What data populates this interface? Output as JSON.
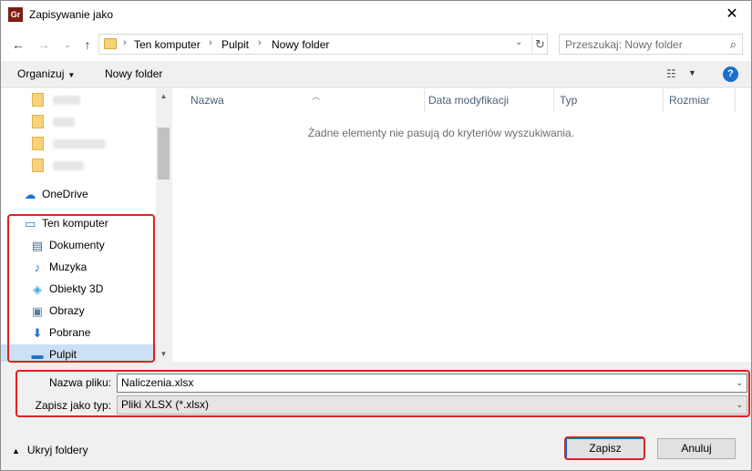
{
  "window": {
    "title": "Zapisywanie jako",
    "app_icon_label": "Gr",
    "close_glyph": "✕"
  },
  "address": {
    "breadcrumbs": [
      "Ten komputer",
      "Pulpit",
      "Nowy folder"
    ],
    "search_placeholder": "Przeszukaj: Nowy folder"
  },
  "toolbar": {
    "organize_label": "Organizuj",
    "new_folder_label": "Nowy folder"
  },
  "navpane": {
    "onedrive_label": "OneDrive",
    "this_pc_label": "Ten komputer",
    "items": [
      {
        "label": "Dokumenty",
        "icon": "document-icon"
      },
      {
        "label": "Muzyka",
        "icon": "music-icon"
      },
      {
        "label": "Obiekty 3D",
        "icon": "cube-icon"
      },
      {
        "label": "Obrazy",
        "icon": "pictures-icon"
      },
      {
        "label": "Pobrane",
        "icon": "download-icon"
      },
      {
        "label": "Pulpit",
        "icon": "desktop-icon"
      }
    ]
  },
  "filelist": {
    "columns": [
      "Nazwa",
      "Data modyfikacji",
      "Typ",
      "Rozmiar"
    ],
    "empty_message": "Żadne elementy nie pasują do kryteriów wyszukiwania."
  },
  "form": {
    "filename_label": "Nazwa pliku:",
    "filename_value": "Naliczenia.xlsx",
    "filetype_label": "Zapisz jako typ:",
    "filetype_value": "Pliki XLSX (*.xlsx)"
  },
  "footer": {
    "hide_folders_label": "Ukryj foldery",
    "save_label": "Zapisz",
    "cancel_label": "Anuluj"
  },
  "colors": {
    "highlight": "#e02020",
    "accent": "#0078d7",
    "selection": "#cce0f5"
  }
}
